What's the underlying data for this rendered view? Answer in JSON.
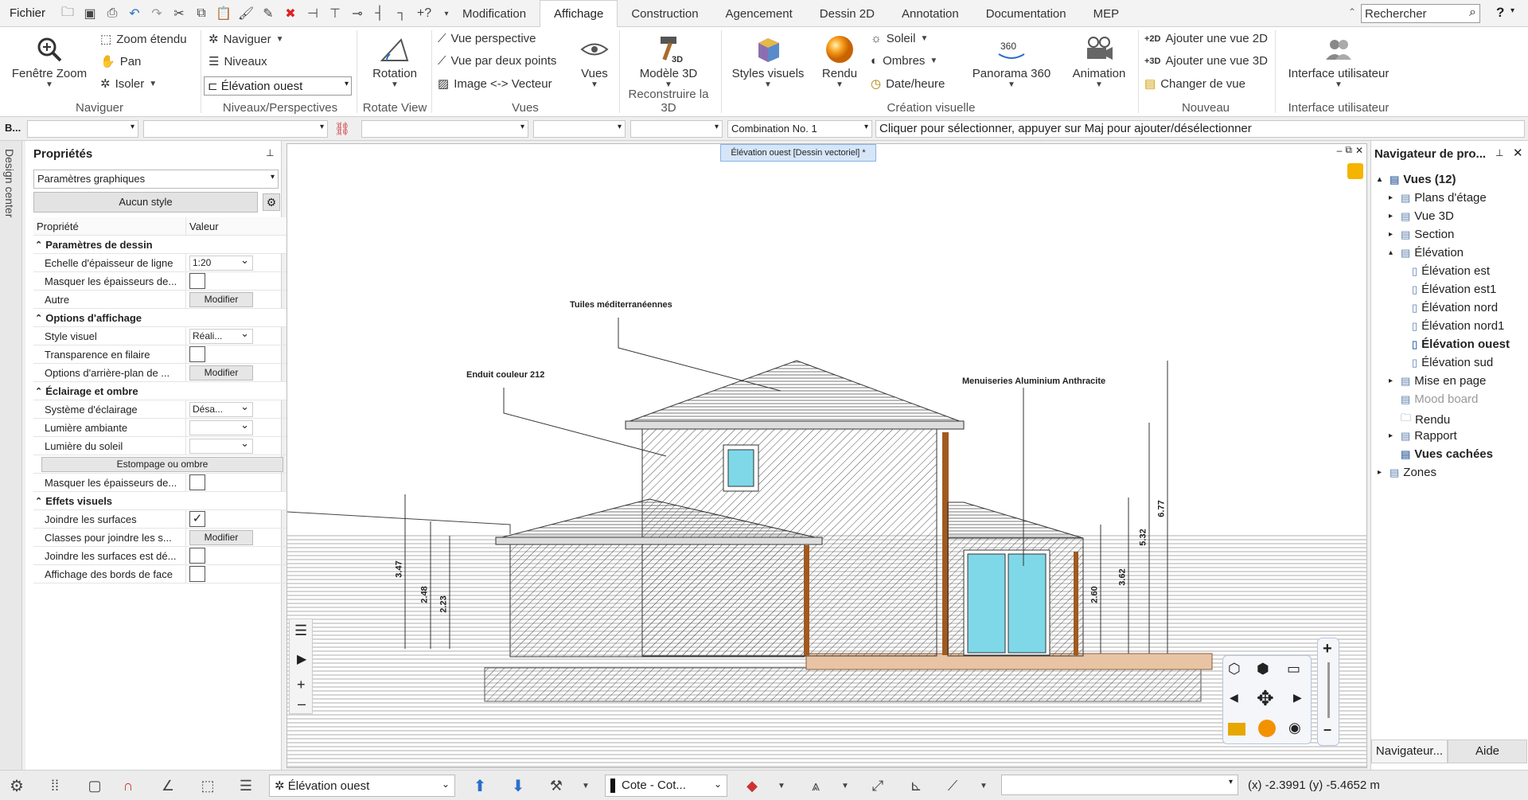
{
  "menu": {
    "file": "Fichier"
  },
  "tabs": [
    "Modification",
    "Affichage",
    "Construction",
    "Agencement",
    "Dessin 2D",
    "Annotation",
    "Documentation",
    "MEP"
  ],
  "search": {
    "placeholder": "Rechercher"
  },
  "help": "?",
  "ribbon": {
    "naviguer": {
      "zoom_window": "Fenêtre Zoom",
      "zoom_extended": "Zoom étendu",
      "pan": "Pan",
      "isolate": "Isoler",
      "label": "Naviguer"
    },
    "levels": {
      "navigate": "Naviguer",
      "levels": "Niveaux",
      "current_view": "Élévation ouest",
      "label": "Niveaux/Perspectives"
    },
    "rotate": {
      "rotation": "Rotation",
      "label": "Rotate View"
    },
    "views": {
      "perspective": "Vue perspective",
      "two_points": "Vue par deux points",
      "image_vector": "Image <-> Vecteur",
      "views": "Vues",
      "label": "Vues"
    },
    "rebuild": {
      "model3d": "Modèle 3D",
      "label": "Reconstruire la 3D"
    },
    "visual": {
      "styles": "Styles visuels",
      "render": "Rendu",
      "sun": "Soleil",
      "shadows": "Ombres",
      "datetime": "Date/heure",
      "panorama": "Panorama 360",
      "animation": "Animation",
      "label": "Création visuelle"
    },
    "new": {
      "add2d": "Ajouter une vue 2D",
      "add3d": "Ajouter une vue 3D",
      "change_view": "Changer de vue",
      "label": "Nouveau"
    },
    "ui": {
      "interface": "Interface utilisateur",
      "label": "Interface utilisateur"
    }
  },
  "optbar": {
    "combination": "Combination No. 1",
    "hint": "Cliquer pour sélectionner, appuyer sur Maj pour ajouter/désélectionner",
    "side_b": "B..."
  },
  "design_center": "Design center",
  "properties": {
    "title": "Propriétés",
    "dropdown": "Paramètres graphiques",
    "style": "Aucun style",
    "col_prop": "Propriété",
    "col_val": "Valeur",
    "rows": [
      {
        "type": "section",
        "name": "Paramètres de dessin"
      },
      {
        "type": "select",
        "name": "Echelle d'épaisseur de ligne",
        "value": "1:20"
      },
      {
        "type": "check",
        "name": "Masquer les épaisseurs de...",
        "value": ""
      },
      {
        "type": "button",
        "name": "Autre",
        "value": "Modifier"
      },
      {
        "type": "section",
        "name": "Options d'affichage"
      },
      {
        "type": "select",
        "name": "Style visuel",
        "value": "Réali..."
      },
      {
        "type": "check",
        "name": "Transparence en filaire",
        "value": ""
      },
      {
        "type": "button",
        "name": "Options d'arrière-plan de ...",
        "value": "Modifier"
      },
      {
        "type": "section",
        "name": "Éclairage et ombre"
      },
      {
        "type": "select",
        "name": "Système d'éclairage",
        "value": "Désa..."
      },
      {
        "type": "select",
        "name": "Lumière ambiante",
        "value": ""
      },
      {
        "type": "select",
        "name": "Lumière du soleil",
        "value": ""
      },
      {
        "type": "wide",
        "name": "Estompage ou ombre",
        "value": ""
      },
      {
        "type": "check",
        "name": "Masquer les épaisseurs de...",
        "value": ""
      },
      {
        "type": "section",
        "name": "Effets visuels"
      },
      {
        "type": "check",
        "name": "Joindre les surfaces",
        "value": "✓"
      },
      {
        "type": "button",
        "name": "Classes pour joindre les s...",
        "value": "Modifier"
      },
      {
        "type": "check",
        "name": "Joindre les surfaces est dé...",
        "value": ""
      },
      {
        "type": "check",
        "name": "Affichage des bords de face",
        "value": ""
      }
    ]
  },
  "canvas": {
    "tab_label": "Élévation ouest [Dessin vectoriel] *",
    "annotations": [
      "Tuiles méditerranéennes",
      "Enduit couleur 212",
      "Menuiseries Aluminium Anthracite"
    ],
    "dims": [
      "3.47",
      "2.48",
      "2.23",
      "2.60",
      "3.62",
      "5.32",
      "6.77"
    ]
  },
  "navigator": {
    "title": "Navigateur de pro...",
    "items": [
      {
        "label": "Vues (12)",
        "level": 0,
        "bold": true,
        "exp": "▴"
      },
      {
        "label": "Plans d'étage",
        "level": 1,
        "exp": "▸"
      },
      {
        "label": "Vue 3D",
        "level": 1,
        "exp": "▸"
      },
      {
        "label": "Section",
        "level": 1,
        "exp": "▸"
      },
      {
        "label": "Élévation",
        "level": 1,
        "exp": "▴"
      },
      {
        "label": "Élévation est",
        "level": 2,
        "exp": ""
      },
      {
        "label": "Élévation est1",
        "level": 2,
        "exp": ""
      },
      {
        "label": "Élévation nord",
        "level": 2,
        "exp": ""
      },
      {
        "label": "Élévation nord1",
        "level": 2,
        "exp": ""
      },
      {
        "label": "Élévation ouest",
        "level": 2,
        "bold": true,
        "exp": ""
      },
      {
        "label": "Élévation sud",
        "level": 2,
        "exp": ""
      },
      {
        "label": "Mise en page",
        "level": 1,
        "exp": "▸"
      },
      {
        "label": "Mood board",
        "level": 1,
        "exp": "",
        "grey": true
      },
      {
        "label": "Rendu",
        "level": 1,
        "exp": ""
      },
      {
        "label": "Rapport",
        "level": 1,
        "exp": "▸"
      },
      {
        "label": "Vues cachées",
        "level": 1,
        "bold": true,
        "exp": ""
      },
      {
        "label": "Zones",
        "level": 0,
        "exp": "▸"
      }
    ],
    "tab_nav": "Navigateur...",
    "tab_help": "Aide"
  },
  "bottombar": {
    "view": "Élévation ouest",
    "layer": "Cote - Cot...",
    "coords": "(x) -2.3991   (y) -5.4652 m"
  }
}
